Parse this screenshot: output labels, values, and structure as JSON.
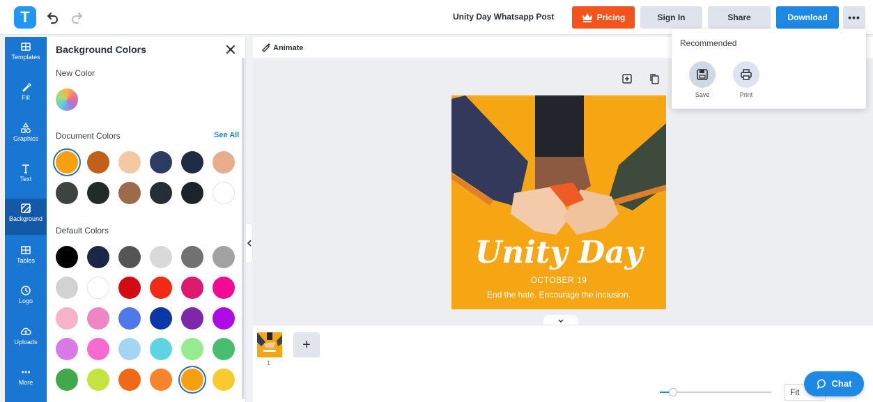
{
  "app": {
    "logo_letter": "T"
  },
  "header": {
    "doc_title": "Unity Day Whatsapp Post",
    "pricing_label": "Pricing",
    "signin_label": "Sign In",
    "share_label": "Share",
    "download_label": "Download",
    "more_label": "•••"
  },
  "sidebar": {
    "items": [
      {
        "label": "Templates",
        "icon": "templates-icon"
      },
      {
        "label": "Fill",
        "icon": "fill-icon"
      },
      {
        "label": "Graphics",
        "icon": "graphics-icon"
      },
      {
        "label": "Text",
        "icon": "text-icon"
      },
      {
        "label": "Background",
        "icon": "background-icon",
        "active": true
      },
      {
        "label": "Tables",
        "icon": "tables-icon"
      },
      {
        "label": "Logo",
        "icon": "logo-icon"
      },
      {
        "label": "Uploads",
        "icon": "uploads-icon"
      },
      {
        "label": "More",
        "icon": "more-icon"
      }
    ]
  },
  "panel": {
    "title": "Background Colors",
    "new_color_label": "New Color",
    "document_colors_label": "Document Colors",
    "see_all_label": "See All",
    "default_colors_label": "Default Colors",
    "document_colors": [
      "#f5a011",
      "#c0601b",
      "#f4c8a2",
      "#2d3c63",
      "#1f2a44",
      "#e8ad8c",
      "#3d4440",
      "#232b29",
      "#9c6b4c",
      "#272d37",
      "#1c2229",
      "#ffffff"
    ],
    "selected_document_color": "#f5a011",
    "default_colors": [
      "#000000",
      "#1c2748",
      "#555555",
      "#d9d9d9",
      "#717171",
      "#a2a2a2",
      "#d2d2d2",
      "#ffffff",
      "#d30b12",
      "#f02a14",
      "#dc1a6e",
      "#f40a95",
      "#f7b3c9",
      "#ee85c4",
      "#4f79e9",
      "#0c37a8",
      "#7e27a9",
      "#af0be4",
      "#d979e8",
      "#f66ad2",
      "#a4d6f3",
      "#5ed4e2",
      "#96eb8e",
      "#47be6f",
      "#3fa94c",
      "#c3e43e",
      "#f16817",
      "#f5842c",
      "#f5a011",
      "#f8ca2d"
    ],
    "selected_default_color": "#f5a011"
  },
  "toolbar": {
    "animate_label": "Animate"
  },
  "artboard": {
    "title": "Unity Day",
    "date": "OCTOBER 19",
    "tagline": "End the hate. Encourage the inclusion."
  },
  "pages": {
    "page_number": "1",
    "add_label": "+"
  },
  "zoom": {
    "fit_label": "Fit",
    "level": 0.12
  },
  "chat": {
    "label": "Chat"
  },
  "dropdown": {
    "title": "Recommended",
    "items": [
      {
        "label": "Save",
        "icon": "save-icon"
      },
      {
        "label": "Print",
        "icon": "print-icon"
      }
    ]
  },
  "colors": {
    "accent": "#1976d2",
    "pricing": "#f2541b",
    "artboard": "#f6a613"
  }
}
